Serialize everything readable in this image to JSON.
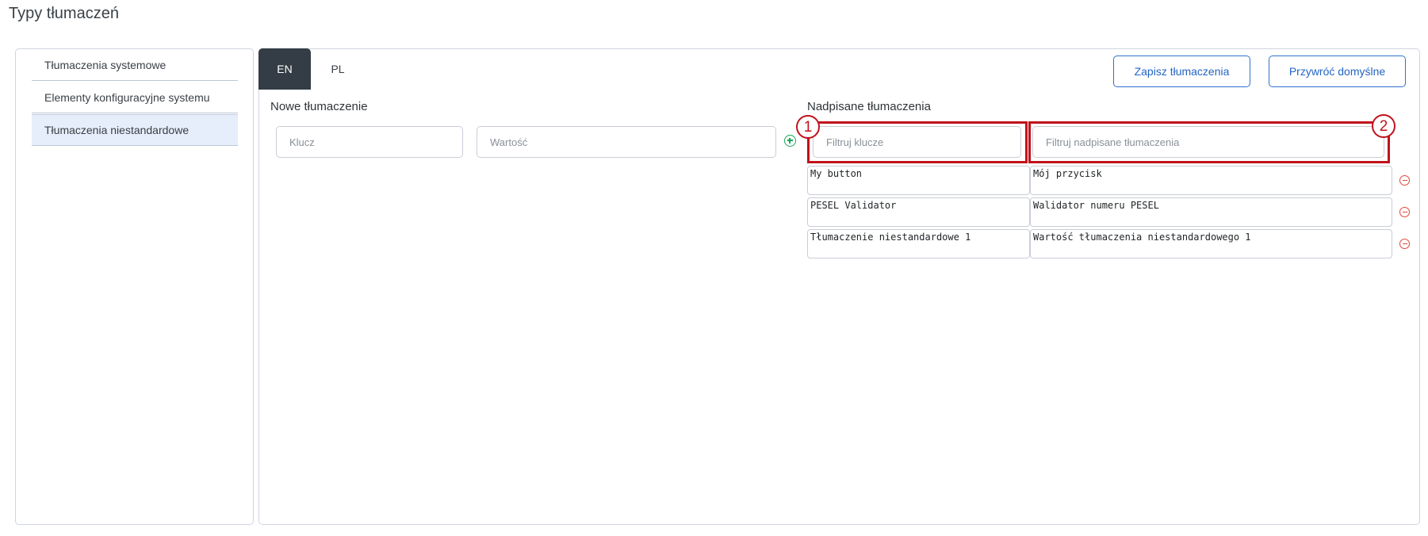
{
  "page": {
    "title": "Typy tłumaczeń"
  },
  "sidebar": {
    "items": [
      {
        "label": "Tłumaczenia systemowe"
      },
      {
        "label": "Elementy konfiguracyjne systemu"
      },
      {
        "label": "Tłumaczenia niestandardowe",
        "active": true
      }
    ]
  },
  "tabs": [
    {
      "label": "EN",
      "active": true
    },
    {
      "label": "PL"
    }
  ],
  "toolbar": {
    "save_label": "Zapisz tłumaczenia",
    "restore_label": "Przywróć domyślne"
  },
  "new_translation": {
    "title": "Nowe tłumaczenie",
    "key_placeholder": "Klucz",
    "value_placeholder": "Wartość",
    "add_icon": "plus-circle-icon"
  },
  "overridden": {
    "title": "Nadpisane tłumaczenia",
    "filter_keys_placeholder": "Filtruj klucze",
    "filter_values_placeholder": "Filtruj nadpisane tłumaczenia",
    "rows": [
      {
        "key": "My button",
        "value": "Mój przycisk"
      },
      {
        "key": "PESEL Validator",
        "value": "Walidator numeru PESEL"
      },
      {
        "key": "Tłumaczenie niestandardowe 1",
        "value": "Wartość tłumaczenia niestandardowego 1"
      }
    ],
    "remove_icon": "minus-circle-icon"
  },
  "annotations": {
    "marker_1": "1",
    "marker_2": "2",
    "color": "#c0121b"
  },
  "colors": {
    "accent": "#2f72d0",
    "tab_active_bg": "#343d45",
    "add": "#19a55a",
    "remove": "#e3473a"
  }
}
